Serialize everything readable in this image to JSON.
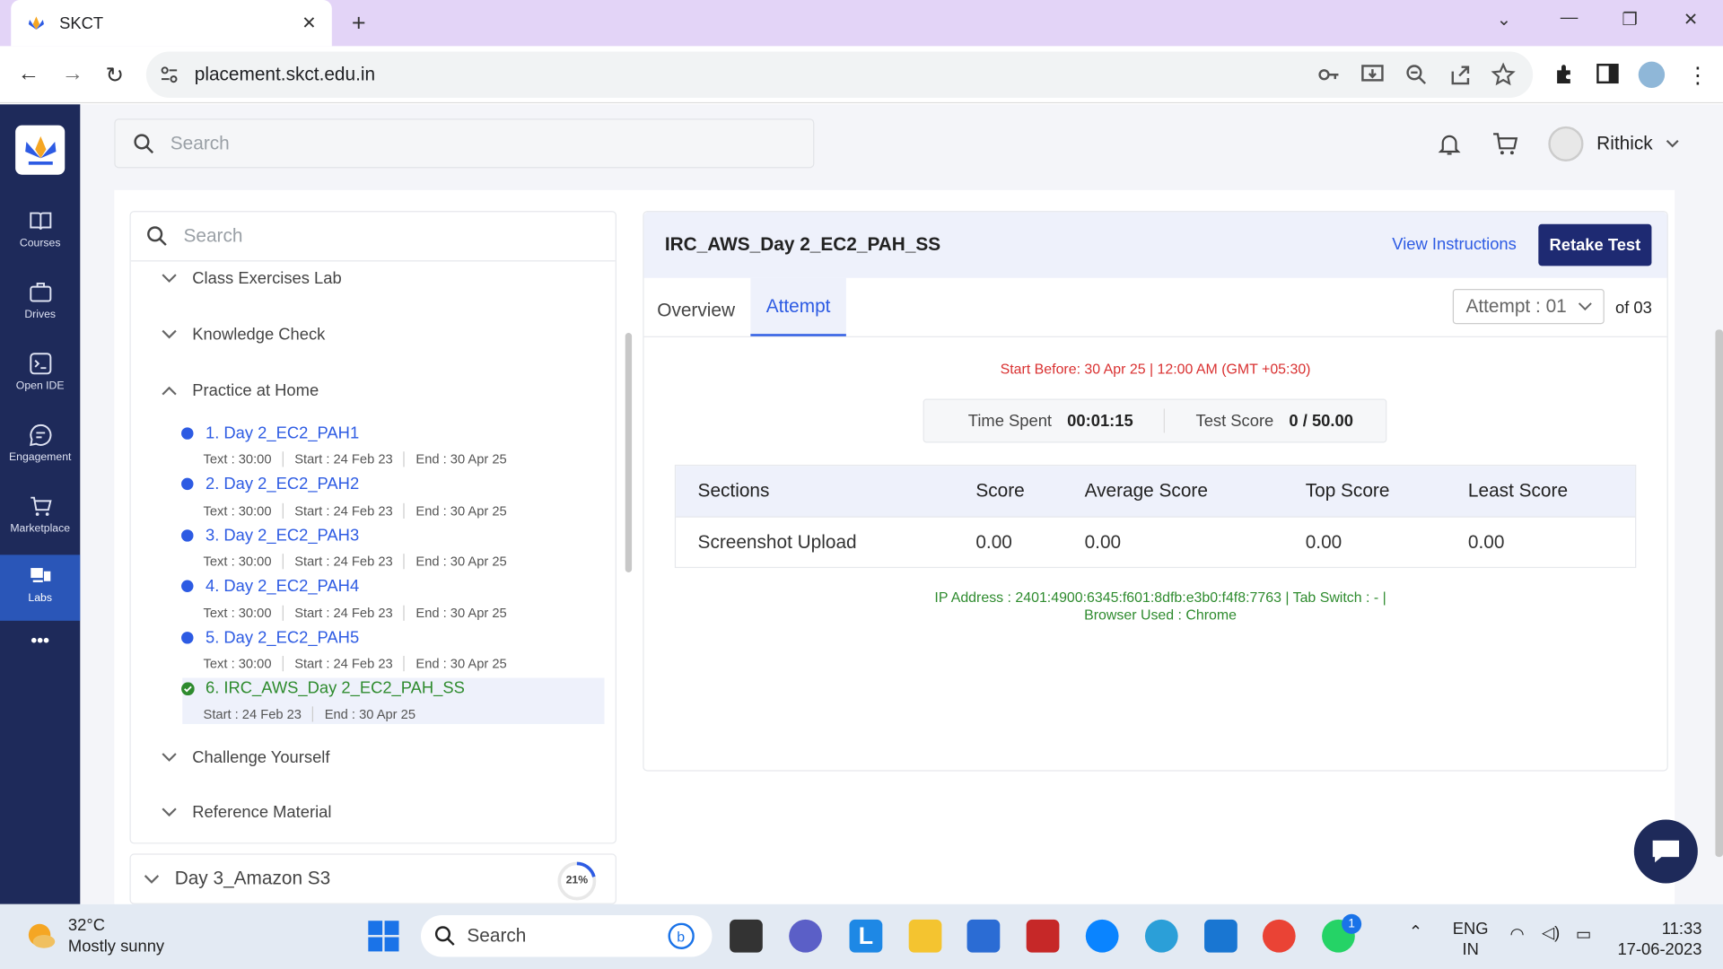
{
  "browser": {
    "tab_title": "SKCT",
    "url": "placement.skct.edu.in"
  },
  "sidebar": {
    "items": [
      {
        "label": "Courses"
      },
      {
        "label": "Drives"
      },
      {
        "label": "Open IDE"
      },
      {
        "label": "Engagement"
      },
      {
        "label": "Marketplace"
      },
      {
        "label": "Labs"
      }
    ],
    "more": "•••"
  },
  "header": {
    "search_placeholder": "Search",
    "user_name": "Rithick"
  },
  "left": {
    "search_placeholder": "Search",
    "sections": [
      "Class Exercises Lab",
      "Knowledge Check",
      "Practice at Home",
      "Challenge Yourself",
      "Reference Material"
    ],
    "items": [
      {
        "label": "1. Day 2_EC2_PAH1",
        "text": "Text : 30:00",
        "start": "Start : 24 Feb 23",
        "end": "End : 30 Apr 25"
      },
      {
        "label": "2. Day 2_EC2_PAH2",
        "text": "Text : 30:00",
        "start": "Start : 24 Feb 23",
        "end": "End : 30 Apr 25"
      },
      {
        "label": "3. Day 2_EC2_PAH3",
        "text": "Text : 30:00",
        "start": "Start : 24 Feb 23",
        "end": "End : 30 Apr 25"
      },
      {
        "label": "4. Day 2_EC2_PAH4",
        "text": "Text : 30:00",
        "start": "Start : 24 Feb 23",
        "end": "End : 30 Apr 25"
      },
      {
        "label": "5. Day 2_EC2_PAH5",
        "text": "Text : 30:00",
        "start": "Start : 24 Feb 23",
        "end": "End : 30 Apr 25"
      },
      {
        "label": "6. IRC_AWS_Day 2_EC2_PAH_SS",
        "start": "Start : 24 Feb 23",
        "end": "End : 30 Apr 25"
      }
    ],
    "next_module": {
      "label": "Day 3_Amazon S3",
      "progress": "21%",
      "progress_value": 0.21
    }
  },
  "test": {
    "title": "IRC_AWS_Day 2_EC2_PAH_SS",
    "view_instructions": "View Instructions",
    "retake": "Retake Test",
    "tabs": [
      "Overview",
      "Attempt"
    ],
    "attempt_select": "Attempt : 01",
    "attempt_of": "of 03",
    "start_before": "Start Before: 30 Apr 25 | 12:00 AM (GMT +05:30)",
    "time_spent_label": "Time Spent",
    "time_spent": "00:01:15",
    "test_score_label": "Test Score",
    "test_score": "0 / 50.00",
    "table": {
      "headers": [
        "Sections",
        "Score",
        "Average Score",
        "Top Score",
        "Least Score"
      ],
      "rows": [
        [
          "Screenshot Upload",
          "0.00",
          "0.00",
          "0.00",
          "0.00"
        ]
      ]
    },
    "ip_info": "IP Address : 2401:4900:6345:f601:8dfb:e3b0:f4f8:7763 | Tab Switch : - | Browser Used : Chrome"
  },
  "taskbar": {
    "temp": "32°C",
    "weather": "Mostly sunny",
    "search": "Search",
    "lang1": "ENG",
    "lang2": "IN",
    "time": "11:33",
    "date": "17-06-2023",
    "whatsapp_badge": "1"
  }
}
